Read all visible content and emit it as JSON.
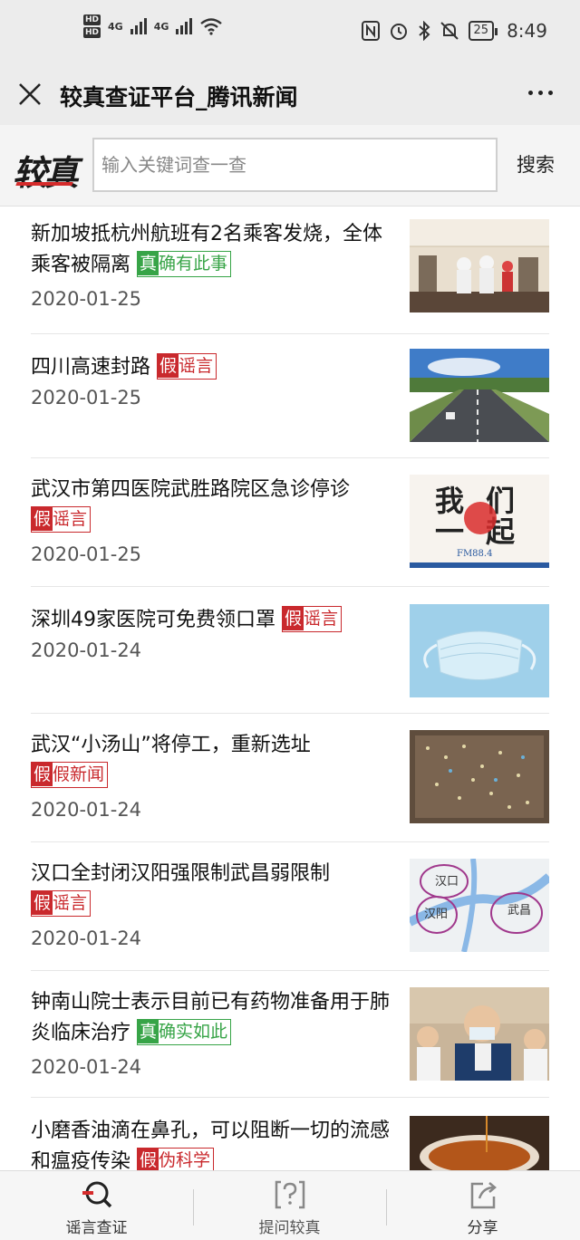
{
  "status_bar": {
    "hd1": "HD",
    "hd2": "HD",
    "net1": "4G",
    "net2": "4G",
    "battery": "25",
    "time": "8:49"
  },
  "title_bar": {
    "title": "较真查证平台_腾讯新闻"
  },
  "search": {
    "logo_text": "较真",
    "placeholder": "输入关键词查一查",
    "button_label": "搜索"
  },
  "news": [
    {
      "title": "新加坡抵杭州航班有2名乘客发烧，全体乘客被隔离",
      "tag_pre": "真",
      "tag_label": "确有此事",
      "verdict": "true",
      "date": "2020-01-25",
      "thumb": "airplane-cabin-image"
    },
    {
      "title": "四川高速封路",
      "tag_pre": "假",
      "tag_label": "谣言",
      "verdict": "false",
      "date": "2020-01-25",
      "thumb": "highway-image"
    },
    {
      "title": "武汉市第四医院武胜路院区急诊停诊",
      "tag_pre": "假",
      "tag_label": "谣言",
      "verdict": "false",
      "date": "2020-01-25",
      "thumb": "poster-image",
      "thumb_text": [
        "我",
        "们",
        "一",
        "起"
      ],
      "thumb_small": "FM88.4"
    },
    {
      "title": "深圳49家医院可免费领口罩",
      "tag_pre": "假",
      "tag_label": "谣言",
      "verdict": "false",
      "date": "2020-01-24",
      "thumb": "mask-image"
    },
    {
      "title": "武汉“小汤山”将停工，重新选址",
      "tag_pre": "假",
      "tag_label": "假新闻",
      "verdict": "false",
      "date": "2020-01-24",
      "thumb": "construction-site-image"
    },
    {
      "title": "汉口全封闭汉阳强限制武昌弱限制",
      "tag_pre": "假",
      "tag_label": "谣言",
      "verdict": "false",
      "date": "2020-01-24",
      "thumb": "map-image",
      "map_labels": [
        "汉口",
        "汉阳",
        "武昌"
      ]
    },
    {
      "title": "钟南山院士表示目前已有药物准备用于肺炎临床治疗",
      "tag_pre": "真",
      "tag_label": "确实如此",
      "verdict": "true",
      "date": "2020-01-24",
      "thumb": "doctor-image"
    },
    {
      "title": "小磨香油滴在鼻孔，可以阻断一切的流感和瘟疫传染",
      "tag_pre": "假",
      "tag_label": "伪科学",
      "verdict": "false",
      "date": "",
      "thumb": "sesame-oil-image"
    }
  ],
  "bottom_nav": {
    "items": [
      {
        "label": "谣言查证",
        "icon": "magnify-check-icon"
      },
      {
        "label": "提问较真",
        "icon": "question-bracket-icon"
      },
      {
        "label": "分享",
        "icon": "share-icon"
      }
    ]
  },
  "colors": {
    "true_tag": "#37a447",
    "false_tag": "#c9292d",
    "accent": "#d52b2b"
  }
}
